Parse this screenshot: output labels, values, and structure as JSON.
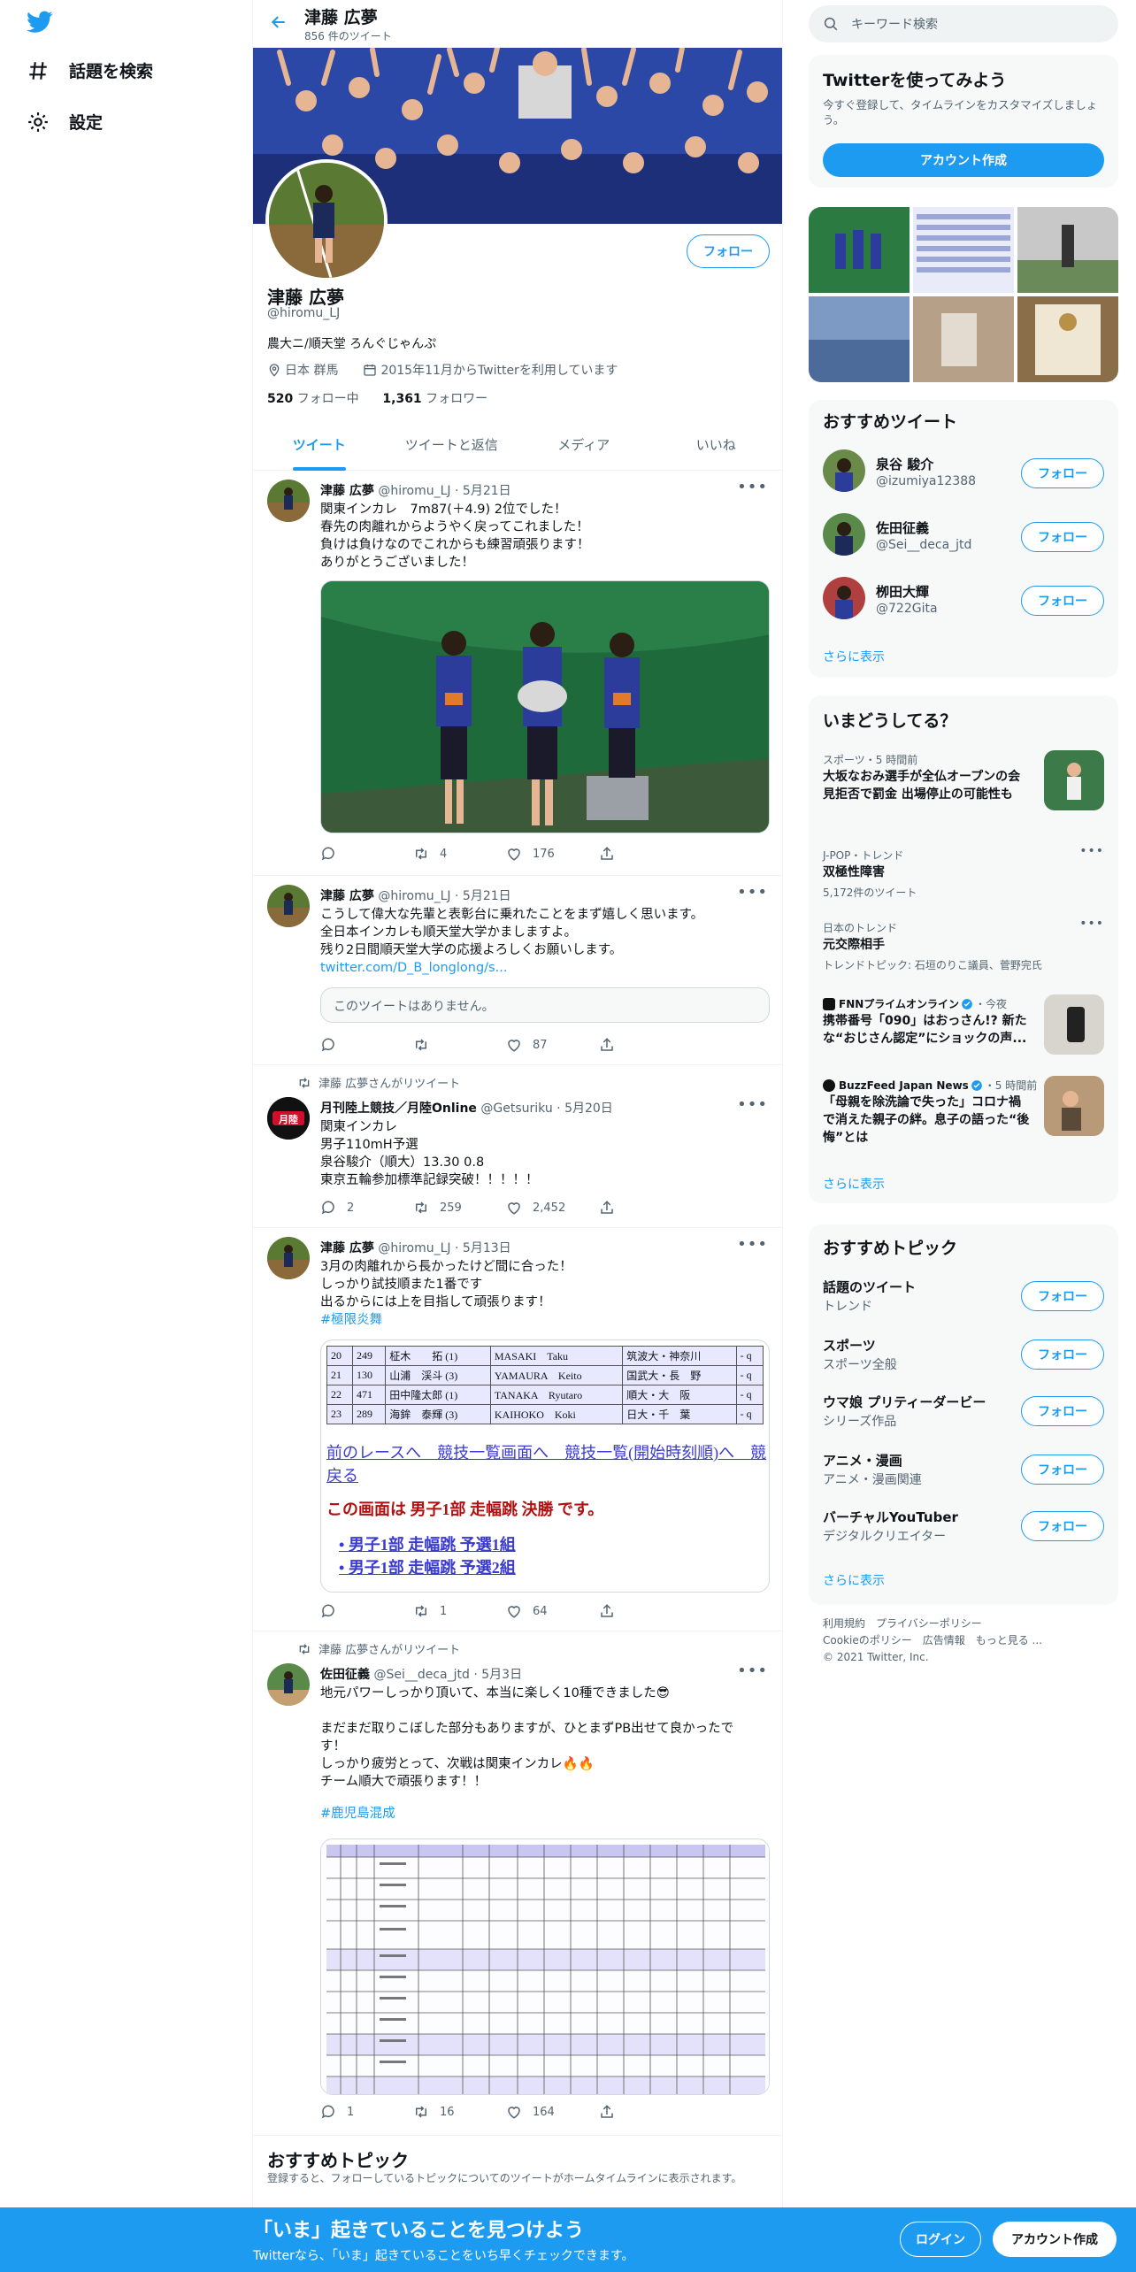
{
  "nav": {
    "explore": "話題を検索",
    "settings": "設定"
  },
  "header": {
    "name": "津藤 広夢",
    "tweet_count": "856 件のツイート"
  },
  "profile": {
    "name": "津藤 広夢",
    "handle": "@hiromu_LJ",
    "bio": "農大ニ/順天堂 ろんぐじゃんぷ",
    "location": "日本 群馬",
    "joined": "2015年11月からTwitterを利用しています",
    "following_count": "520",
    "following_label": "フォロー中",
    "followers_count": "1,361",
    "followers_label": "フォロワー",
    "follow_button": "フォロー"
  },
  "tabs": [
    "ツイート",
    "ツイートと返信",
    "メディア",
    "いいね"
  ],
  "tweets": [
    {
      "name": "津藤 広夢",
      "handle": "@hiromu_LJ",
      "date": "5月21日",
      "text": "関東インカレ　7m87(＋4.9) 2位でした！\n春先の肉離れからようやく戻ってこれました！\n負けは負けなのでこれからも練習頑張ります！\nありがとうございました！",
      "reply": "",
      "retweet": "4",
      "like": "176"
    },
    {
      "name": "津藤 広夢",
      "handle": "@hiromu_LJ",
      "date": "5月21日",
      "text": "こうして偉大な先輩と表彰台に乗れたことをまず嬉しく思います。\n全日本インカレも順天堂大学かましますよ。\n残り2日間順天堂大学の応援よろしくお願いします。",
      "link": "twitter.com/D_B_longlong/s...",
      "quote": "このツイートはありません。",
      "reply": "",
      "retweet": "",
      "like": "87"
    },
    {
      "retweeted_by": "津藤 広夢さんがリツイート",
      "name": "月刊陸上競技／月陸Online",
      "handle": "@Getsuriku",
      "date": "5月20日",
      "text": "関東インカレ\n男子110mH予選\n泉谷駿介（順大）13.30 0.8\n東京五輪参加標準記録突破！！！！！",
      "reply": "2",
      "retweet": "259",
      "like": "2,452"
    },
    {
      "name": "津藤 広夢",
      "handle": "@hiromu_LJ",
      "date": "5月13日",
      "text": "3月の肉離れから長かったけど間に合った！\nしっかり試技順また1番です\n出るからには上を目指して頑張ります！",
      "hashtag": "#極限炎舞",
      "reply": "",
      "retweet": "1",
      "like": "64"
    },
    {
      "retweeted_by": "津藤 広夢さんがリツイート",
      "name": "佐田征義",
      "handle": "@Sei__deca_jtd",
      "date": "5月3日",
      "text": "地元パワーしっかり頂いて、本当に楽しく10種できました😎\n\nまだまだ取りこぼした部分もありますが、ひとまずPB出せて良かったで\nす！\nしっかり疲労とって、次戦は関東インカレ🔥🔥\nチーム順大で頑張ります！！",
      "hashtag": "#鹿児島混成",
      "reply": "1",
      "retweet": "16",
      "like": "164"
    }
  ],
  "result_screen": {
    "rows": [
      [
        "20",
        "249",
        "柾木　　拓 (1)",
        "MASAKI　Taku",
        "筑波大・神奈川",
        "- q"
      ],
      [
        "21",
        "130",
        "山浦　渓斗 (3)",
        "YAMAURA　Keito",
        "国武大・長　野",
        "- q"
      ],
      [
        "22",
        "471",
        "田中隆太郎 (1)",
        "TANAKA　Ryutaro",
        "順大・大　阪",
        "- q"
      ],
      [
        "23",
        "289",
        "海鉾　泰輝 (3)",
        "KAIHOKO　Koki",
        "日大・千　葉",
        "- q"
      ]
    ],
    "links": "前のレースへ　競技一覧画面へ　競技一覧(開始時刻順)へ　競",
    "back": "戻る",
    "heading": "この画面は 男子1部 走幅跳 決勝 です。",
    "bullet1": "男子1部 走幅跳 予選1組",
    "bullet2": "男子1部 走幅跳 予選2組"
  },
  "search": {
    "placeholder": "キーワード検索"
  },
  "signup_panel": {
    "title": "Twitterを使ってみよう",
    "text": "今すぐ登録して、タイムラインをカスタマイズしましょう。",
    "button": "アカウント作成"
  },
  "recommended_tweets": {
    "title": "おすすめツイート",
    "users": [
      {
        "name": "泉谷 駿介",
        "handle": "@izumiya12388"
      },
      {
        "name": "佐田征義",
        "handle": "@Sei__deca_jtd"
      },
      {
        "name": "栁田大輝",
        "handle": "@722Gita"
      }
    ],
    "follow": "フォロー",
    "more": "さらに表示"
  },
  "trends": {
    "title": "いまどうしてる？",
    "items": [
      {
        "meta": "スポーツ・5 時間前",
        "title": "大坂なおみ選手が全仏オープンの会見拒否で罰金 出場停止の可能性も"
      },
      {
        "meta": "J-POP・トレンド",
        "title": "双極性障害",
        "sub": "5,172件のツイート"
      },
      {
        "meta": "日本のトレンド",
        "title": "元交際相手",
        "sub": "トレンドトピック: 石垣のりこ議員、菅野完氏"
      },
      {
        "source": "FNNプライムオンライン",
        "meta": "・今夜",
        "title": "携帯番号「090」はおっさん!? 新たな“おじさん認定”にショックの声..."
      },
      {
        "source": "BuzzFeed Japan News",
        "meta": "・5 時間前",
        "title": "「母親を除洗論で失った」コロナ禍で消えた親子の絆。息子の語った“後悔”とは"
      }
    ],
    "more": "さらに表示"
  },
  "topics": {
    "title": "おすすめトピック",
    "items": [
      {
        "name": "話題のツイート",
        "sub": "トレンド"
      },
      {
        "name": "スポーツ",
        "sub": "スポーツ全般"
      },
      {
        "name": "ウマ娘 プリティーダービー",
        "sub": "シリーズ作品"
      },
      {
        "name": "アニメ・漫画",
        "sub": "アニメ・漫画関連"
      },
      {
        "name": "バーチャルYouTuber",
        "sub": "デジタルクリエイター"
      }
    ],
    "follow": "フォロー",
    "more": "さらに表示"
  },
  "footer": {
    "line1": "利用規約　プライバシーポリシー",
    "line2": "Cookieのポリシー　広告情報　もっと見る ...",
    "line3": "© 2021 Twitter, Inc."
  },
  "center_topics": {
    "title": "おすすめトピック",
    "text": "登録すると、フォローしているトピックについてのツイートがホームタイムラインに表示されます。"
  },
  "bottom_bar": {
    "title": "「いま」起きていることを見つけよう",
    "text": "Twitterなら、「いま」起きていることをいち早くチェックできます。",
    "login": "ログイン",
    "signup": "アカウント作成"
  },
  "colors": {
    "accent": "#1d9bf0",
    "bar": "#1d9bf0"
  }
}
